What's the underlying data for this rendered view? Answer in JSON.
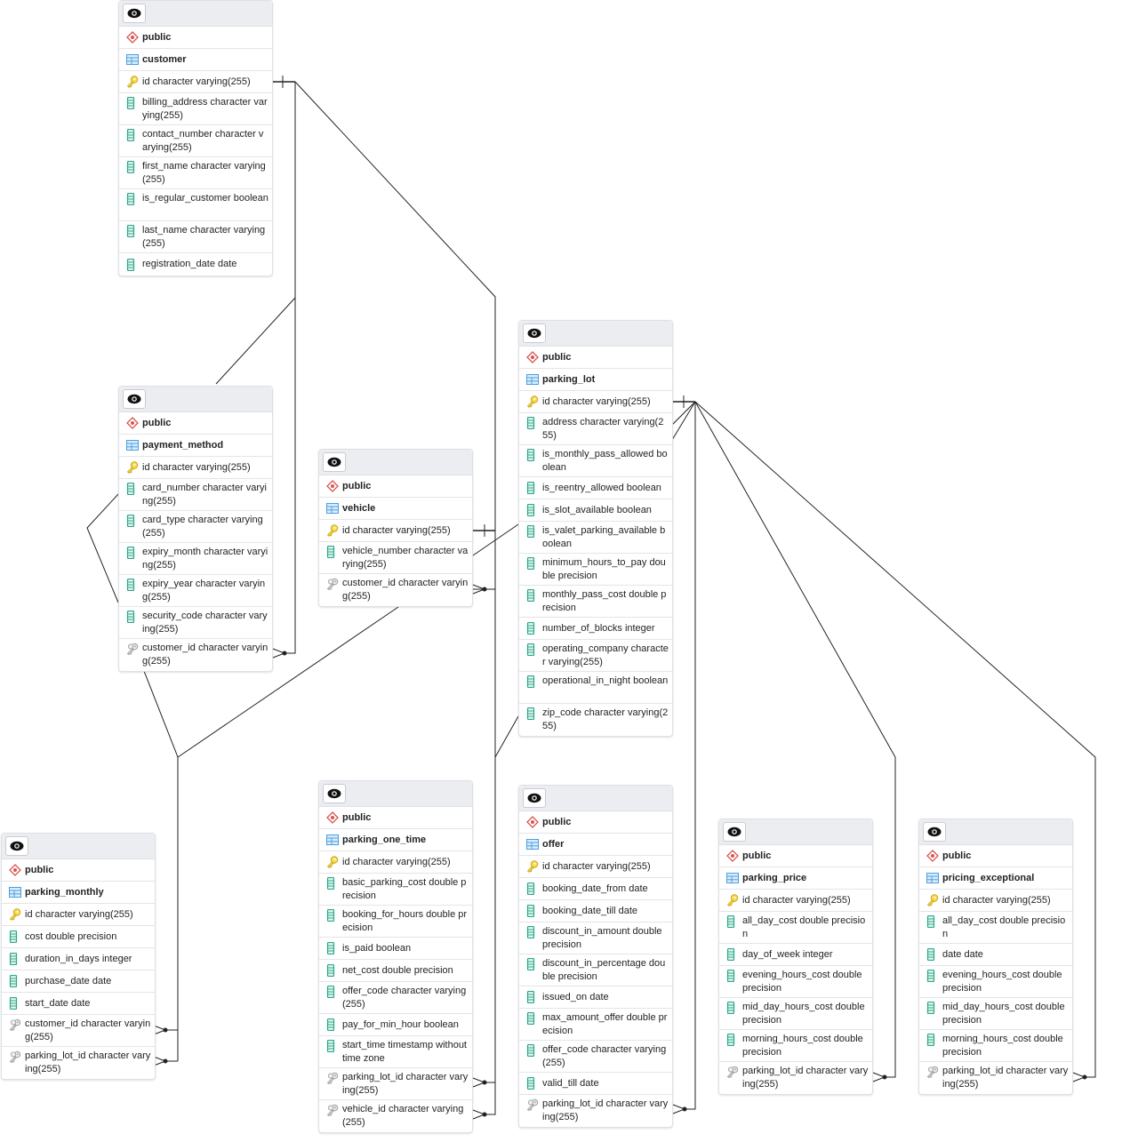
{
  "diagram": {
    "type": "erd",
    "tables": [
      {
        "id": "customer",
        "schema": "public",
        "name": "customer",
        "columns": [
          {
            "kind": "pk",
            "text": "id character varying(255)"
          },
          {
            "kind": "col",
            "text": "billing_address character varying(255)"
          },
          {
            "kind": "col",
            "text": "contact_number character varying(255)"
          },
          {
            "kind": "col",
            "text": "first_name character varying(255)"
          },
          {
            "kind": "col",
            "text": "is_regular_customer boolean"
          },
          {
            "kind": "col",
            "text": "last_name character varying(255)"
          },
          {
            "kind": "col",
            "text": "registration_date date"
          }
        ]
      },
      {
        "id": "payment_method",
        "schema": "public",
        "name": "payment_method",
        "columns": [
          {
            "kind": "pk",
            "text": "id character varying(255)"
          },
          {
            "kind": "col",
            "text": "card_number character varying(255)"
          },
          {
            "kind": "col",
            "text": "card_type character varying(255)"
          },
          {
            "kind": "col",
            "text": "expiry_month character varying(255)"
          },
          {
            "kind": "col",
            "text": "expiry_year character varying(255)"
          },
          {
            "kind": "col",
            "text": "security_code character varying(255)"
          },
          {
            "kind": "fk",
            "text": "customer_id character varying(255)"
          }
        ]
      },
      {
        "id": "vehicle",
        "schema": "public",
        "name": "vehicle",
        "columns": [
          {
            "kind": "pk",
            "text": "id character varying(255)"
          },
          {
            "kind": "col",
            "text": "vehicle_number character varying(255)"
          },
          {
            "kind": "fk",
            "text": "customer_id character varying(255)"
          }
        ]
      },
      {
        "id": "parking_lot",
        "schema": "public",
        "name": "parking_lot",
        "columns": [
          {
            "kind": "pk",
            "text": "id character varying(255)"
          },
          {
            "kind": "col",
            "text": "address character varying(255)"
          },
          {
            "kind": "col",
            "text": "is_monthly_pass_allowed boolean"
          },
          {
            "kind": "col",
            "text": "is_reentry_allowed boolean"
          },
          {
            "kind": "col",
            "text": "is_slot_available boolean"
          },
          {
            "kind": "col",
            "text": "is_valet_parking_available boolean"
          },
          {
            "kind": "col",
            "text": "minimum_hours_to_pay double precision"
          },
          {
            "kind": "col",
            "text": "monthly_pass_cost double precision"
          },
          {
            "kind": "col",
            "text": "number_of_blocks integer"
          },
          {
            "kind": "col",
            "text": "operating_company character varying(255)"
          },
          {
            "kind": "col",
            "text": "operational_in_night boolean"
          },
          {
            "kind": "col",
            "text": "zip_code character varying(255)"
          }
        ]
      },
      {
        "id": "parking_monthly",
        "schema": "public",
        "name": "parking_monthly",
        "columns": [
          {
            "kind": "pk",
            "text": "id character varying(255)"
          },
          {
            "kind": "col",
            "text": "cost double precision"
          },
          {
            "kind": "col",
            "text": "duration_in_days integer"
          },
          {
            "kind": "col",
            "text": "purchase_date date"
          },
          {
            "kind": "col",
            "text": "start_date date"
          },
          {
            "kind": "fk",
            "text": "customer_id character varying(255)"
          },
          {
            "kind": "fk",
            "text": "parking_lot_id character varying(255)"
          }
        ]
      },
      {
        "id": "parking_one_time",
        "schema": "public",
        "name": "parking_one_time",
        "columns": [
          {
            "kind": "pk",
            "text": "id character varying(255)"
          },
          {
            "kind": "col",
            "text": "basic_parking_cost double precision"
          },
          {
            "kind": "col",
            "text": "booking_for_hours double precision"
          },
          {
            "kind": "col",
            "text": "is_paid boolean"
          },
          {
            "kind": "col",
            "text": "net_cost double precision"
          },
          {
            "kind": "col",
            "text": "offer_code character varying(255)"
          },
          {
            "kind": "col",
            "text": "pay_for_min_hour boolean"
          },
          {
            "kind": "col",
            "text": "start_time timestamp without time zone"
          },
          {
            "kind": "fk",
            "text": "parking_lot_id character varying(255)"
          },
          {
            "kind": "fk",
            "text": "vehicle_id character varying(255)"
          }
        ]
      },
      {
        "id": "offer",
        "schema": "public",
        "name": "offer",
        "columns": [
          {
            "kind": "pk",
            "text": "id character varying(255)"
          },
          {
            "kind": "col",
            "text": "booking_date_from date"
          },
          {
            "kind": "col",
            "text": "booking_date_till date"
          },
          {
            "kind": "col",
            "text": "discount_in_amount double precision"
          },
          {
            "kind": "col",
            "text": "discount_in_percentage double precision"
          },
          {
            "kind": "col",
            "text": "issued_on date"
          },
          {
            "kind": "col",
            "text": "max_amount_offer double precision"
          },
          {
            "kind": "col",
            "text": "offer_code character varying(255)"
          },
          {
            "kind": "col",
            "text": "valid_till date"
          },
          {
            "kind": "fk",
            "text": "parking_lot_id character varying(255)"
          }
        ]
      },
      {
        "id": "parking_price",
        "schema": "public",
        "name": "parking_price",
        "columns": [
          {
            "kind": "pk",
            "text": "id character varying(255)"
          },
          {
            "kind": "col",
            "text": "all_day_cost double precision"
          },
          {
            "kind": "col",
            "text": "day_of_week integer"
          },
          {
            "kind": "col",
            "text": "evening_hours_cost double precision"
          },
          {
            "kind": "col",
            "text": "mid_day_hours_cost double precision"
          },
          {
            "kind": "col",
            "text": "morning_hours_cost double precision"
          },
          {
            "kind": "fk",
            "text": "parking_lot_id character varying(255)"
          }
        ]
      },
      {
        "id": "pricing_exceptional",
        "schema": "public",
        "name": "pricing_exceptional",
        "columns": [
          {
            "kind": "pk",
            "text": "id character varying(255)"
          },
          {
            "kind": "col",
            "text": "all_day_cost double precision"
          },
          {
            "kind": "col",
            "text": "date date"
          },
          {
            "kind": "col",
            "text": "evening_hours_cost double precision"
          },
          {
            "kind": "col",
            "text": "mid_day_hours_cost double precision"
          },
          {
            "kind": "col",
            "text": "morning_hours_cost double precision"
          },
          {
            "kind": "fk",
            "text": "parking_lot_id character varying(255)"
          }
        ]
      }
    ],
    "relationships": [
      {
        "from": "payment_method.customer_id",
        "to": "customer.id",
        "cardinality": "many-to-one"
      },
      {
        "from": "vehicle.customer_id",
        "to": "customer.id",
        "cardinality": "many-to-one"
      },
      {
        "from": "parking_monthly.customer_id",
        "to": "customer.id",
        "cardinality": "many-to-one"
      },
      {
        "from": "parking_monthly.parking_lot_id",
        "to": "parking_lot.id",
        "cardinality": "many-to-one"
      },
      {
        "from": "parking_one_time.parking_lot_id",
        "to": "parking_lot.id",
        "cardinality": "many-to-one"
      },
      {
        "from": "parking_one_time.vehicle_id",
        "to": "vehicle.id",
        "cardinality": "many-to-one"
      },
      {
        "from": "offer.parking_lot_id",
        "to": "parking_lot.id",
        "cardinality": "many-to-one"
      },
      {
        "from": "parking_price.parking_lot_id",
        "to": "parking_lot.id",
        "cardinality": "many-to-one"
      },
      {
        "from": "pricing_exceptional.parking_lot_id",
        "to": "parking_lot.id",
        "cardinality": "many-to-one"
      }
    ],
    "icons": {
      "header": "eye-icon",
      "schema": "schema-diamond-icon",
      "table": "table-grid-icon",
      "pk": "primary-key-icon",
      "col": "column-icon",
      "fk": "foreign-key-icon"
    },
    "colors": {
      "schema_icon": "#d9534f",
      "table_icon": "#4a9fe0",
      "pk_icon": "#e8c21a",
      "col_icon": "#2aa889",
      "fk_icon": "#999999",
      "header_bg": "#ebedf1",
      "line": "#222222"
    }
  }
}
